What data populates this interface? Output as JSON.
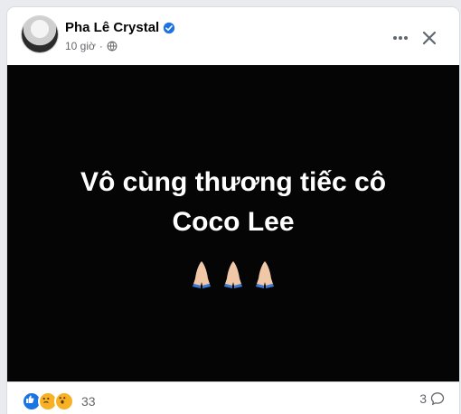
{
  "post": {
    "author": "Pha Lê Crystal",
    "time": "10 giờ",
    "content_text": "Vô cùng thương tiếc cô Coco Lee",
    "reaction_count": "33",
    "comment_count": "3"
  },
  "icons": {
    "verified": "verified-badge-icon",
    "privacy": "globe-icon",
    "more": "more-horizontal-icon",
    "close": "close-icon",
    "praying": "folded-hands-emoji",
    "comment": "comment-bubble-icon"
  },
  "colors": {
    "media_background": "#050505",
    "accent_blue": "#1b74e4",
    "reaction_yellow": "#f7b125",
    "meta_gray": "#65676b"
  }
}
